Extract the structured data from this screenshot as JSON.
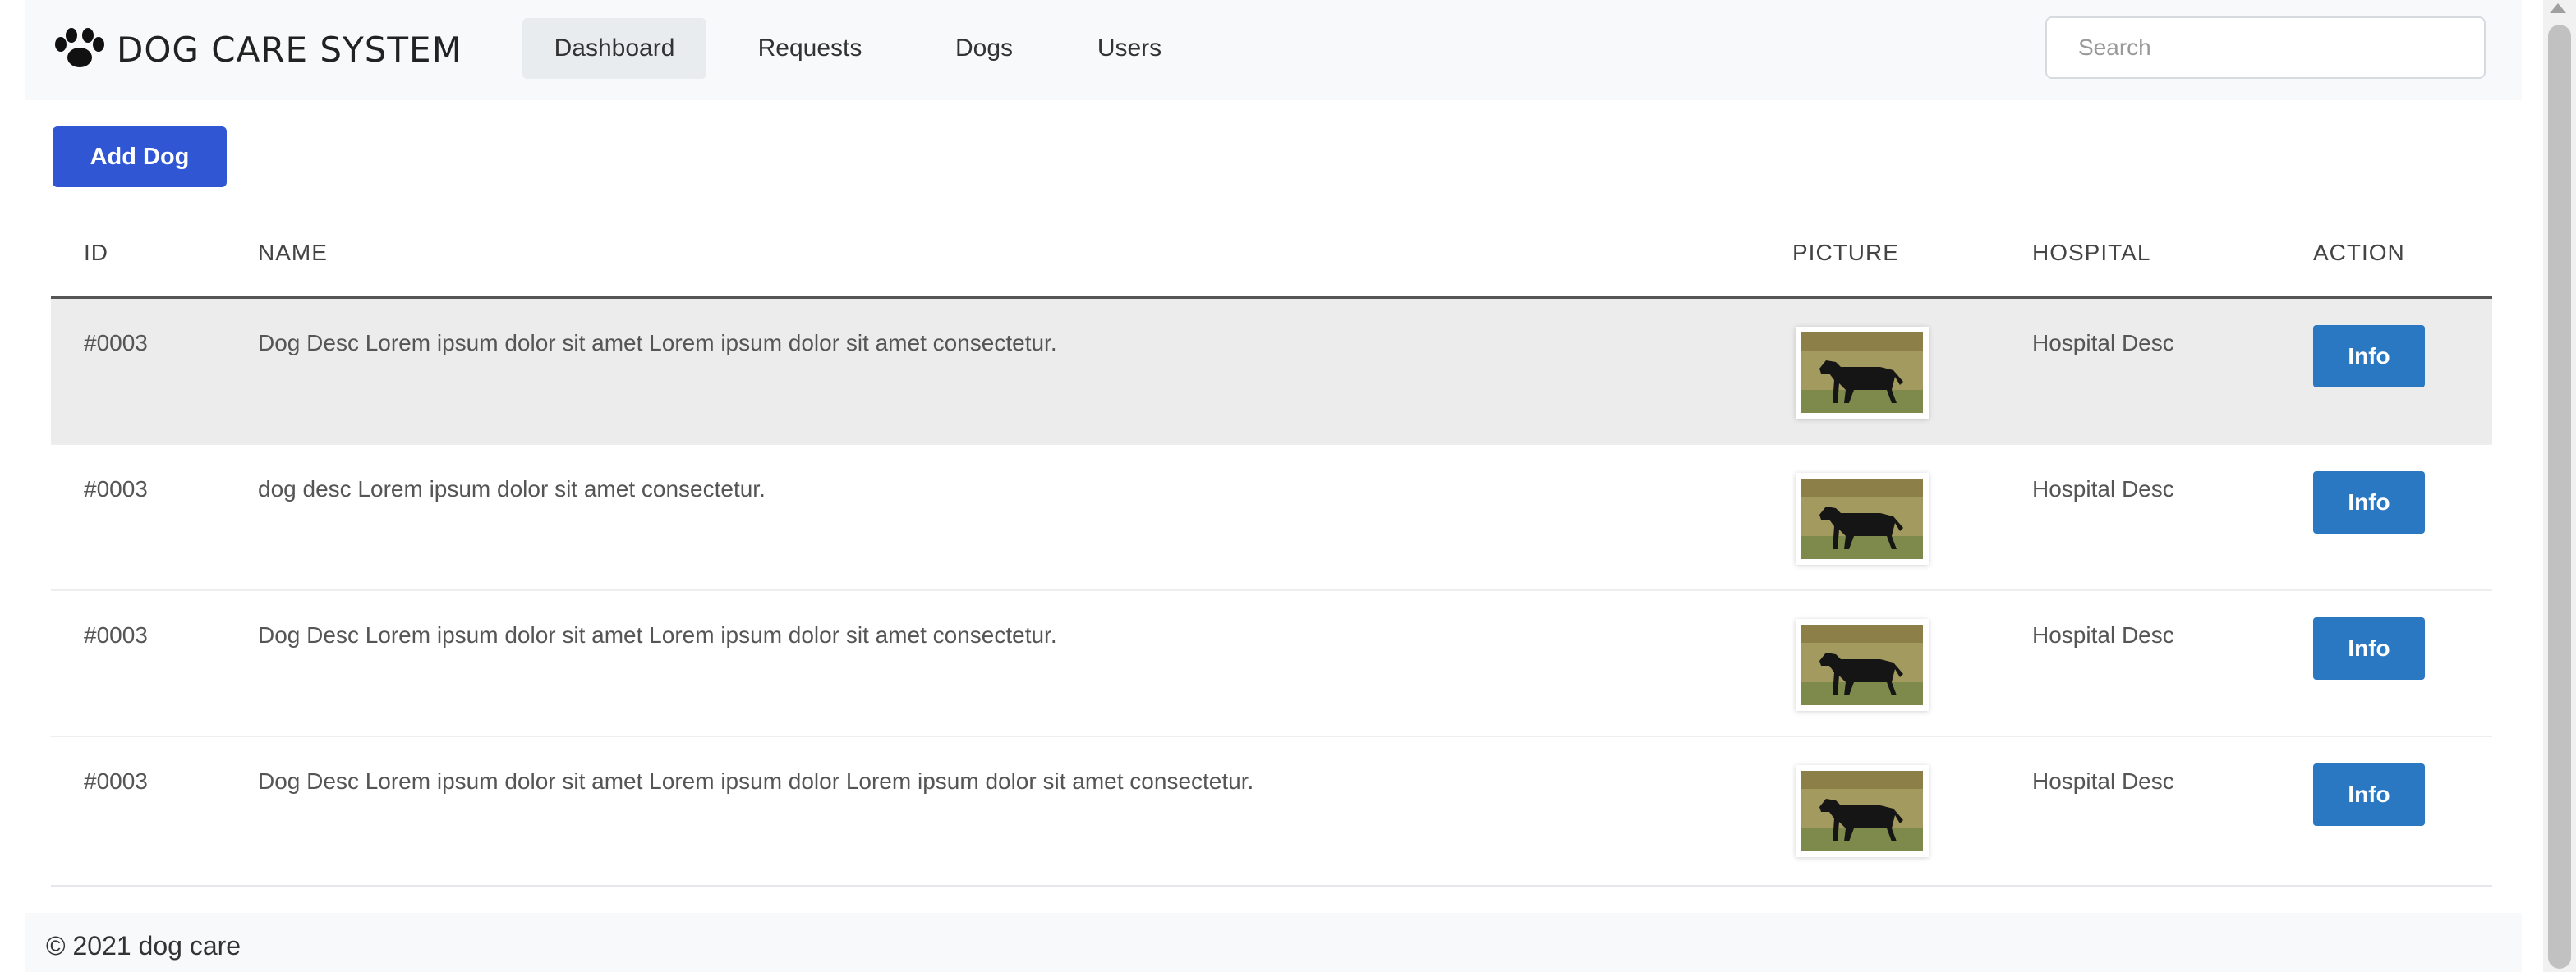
{
  "navbar": {
    "brand": "DOG CARE SYSTEM",
    "brand_icon": "paw-icon",
    "links": [
      {
        "label": "Dashboard",
        "active": true
      },
      {
        "label": "Requests",
        "active": false
      },
      {
        "label": "Dogs",
        "active": false
      },
      {
        "label": "Users",
        "active": false
      }
    ],
    "search_placeholder": "Search"
  },
  "actions": {
    "add_dog_label": "Add Dog"
  },
  "table": {
    "columns": [
      "ID",
      "NAME",
      "PICTURE",
      "HOSPITAL",
      "ACTION"
    ],
    "rows": [
      {
        "id": "#0003",
        "name": "Dog Desc Lorem ipsum dolor sit amet Lorem ipsum dolor sit amet consectetur.",
        "hospital": "Hospital Desc",
        "action": "Info"
      },
      {
        "id": "#0003",
        "name": "dog desc Lorem ipsum dolor sit amet consectetur.",
        "hospital": "Hospital Desc",
        "action": "Info"
      },
      {
        "id": "#0003",
        "name": "Dog Desc Lorem ipsum dolor sit amet Lorem ipsum dolor sit amet consectetur.",
        "hospital": "Hospital Desc",
        "action": "Info"
      },
      {
        "id": "#0003",
        "name": "Dog Desc Lorem ipsum dolor sit amet Lorem ipsum dolor Lorem ipsum dolor sit amet consectetur.",
        "hospital": "Hospital Desc",
        "action": "Info"
      }
    ]
  },
  "footer": {
    "text": "© 2021 dog care"
  },
  "colors": {
    "primary": "#3056d3",
    "info": "#2b78c2",
    "navbar_bg": "#f8f9fa",
    "hover_row": "#ececec"
  }
}
